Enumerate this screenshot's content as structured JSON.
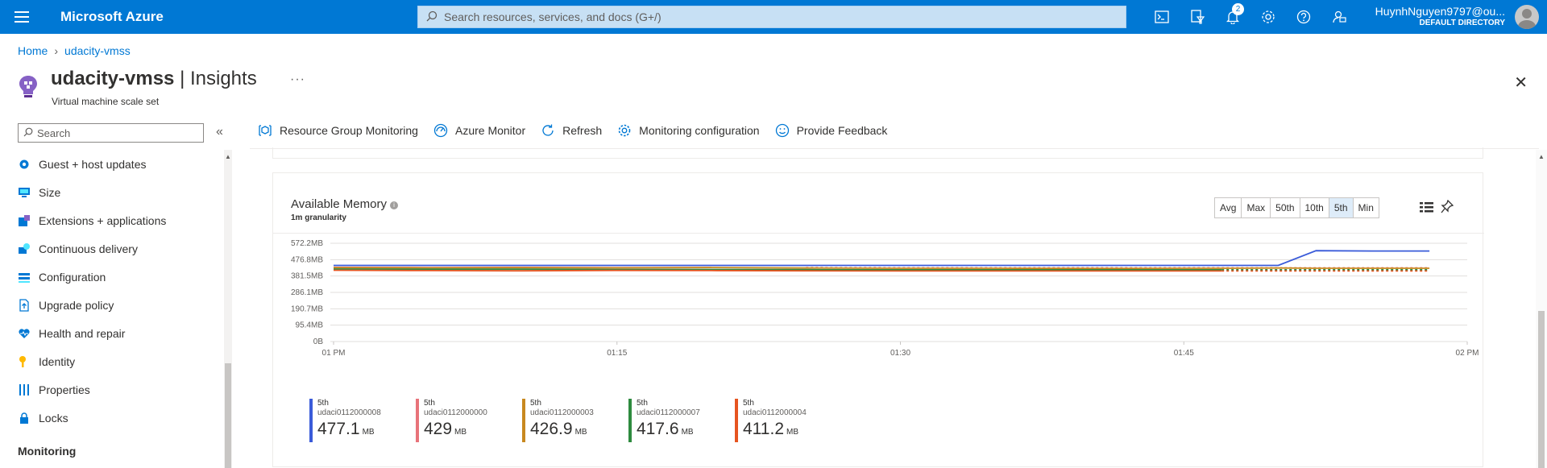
{
  "topbar": {
    "brand": "Microsoft Azure",
    "search_placeholder": "Search resources, services, and docs (G+/)",
    "notification_count": "2",
    "user_name": "HuynhNguyen9797@ou...",
    "user_directory": "DEFAULT DIRECTORY"
  },
  "breadcrumb": {
    "home": "Home",
    "resource": "udacity-vmss"
  },
  "header": {
    "resource_name": "udacity-vmss",
    "blade": "Insights",
    "subtitle": "Virtual machine scale set"
  },
  "sidebar": {
    "search_placeholder": "Search",
    "items": [
      {
        "label": "Guest + host updates",
        "icon": "gear-icon"
      },
      {
        "label": "Size",
        "icon": "monitor-icon"
      },
      {
        "label": "Extensions + applications",
        "icon": "extension-icon"
      },
      {
        "label": "Continuous delivery",
        "icon": "delivery-icon"
      },
      {
        "label": "Configuration",
        "icon": "config-icon"
      },
      {
        "label": "Upgrade policy",
        "icon": "upgrade-icon"
      },
      {
        "label": "Health and repair",
        "icon": "heart-icon"
      },
      {
        "label": "Identity",
        "icon": "key-icon"
      },
      {
        "label": "Properties",
        "icon": "properties-icon"
      },
      {
        "label": "Locks",
        "icon": "lock-icon"
      }
    ],
    "group_label": "Monitoring"
  },
  "commands": [
    {
      "label": "Resource Group Monitoring",
      "icon": "resource-group-icon"
    },
    {
      "label": "Azure Monitor",
      "icon": "monitor-gauge-icon"
    },
    {
      "label": "Refresh",
      "icon": "refresh-icon"
    },
    {
      "label": "Monitoring configuration",
      "icon": "gear-icon"
    },
    {
      "label": "Provide Feedback",
      "icon": "smiley-icon"
    }
  ],
  "card": {
    "title": "Available Memory",
    "granularity": "1m granularity",
    "aggregations": [
      "Avg",
      "Max",
      "50th",
      "10th",
      "5th",
      "Min"
    ],
    "selected_aggregation": "5th"
  },
  "colors": {
    "azure_blue": "#0078d4",
    "series_008": "#3a5bd9",
    "series_000": "#e8737a",
    "series_003": "#c8891f",
    "series_007": "#2e8b3f",
    "series_004": "#e65420"
  },
  "chart_data": {
    "type": "line",
    "title": "Available Memory",
    "ylabel": "",
    "xlabel": "",
    "y_ticks": [
      "572.2MB",
      "476.8MB",
      "381.5MB",
      "286.1MB",
      "190.7MB",
      "95.4MB",
      "0B"
    ],
    "x_ticks": [
      "01 PM",
      "01:15",
      "01:30",
      "01:45",
      "02 PM"
    ],
    "ylim": [
      0,
      572.2
    ],
    "grid": true,
    "x_minutes": [
      0,
      5,
      10,
      15,
      20,
      25,
      30,
      35,
      40,
      45,
      47,
      50,
      52,
      55,
      58
    ],
    "series": [
      {
        "name": "udaci0112000008",
        "color": "#3a5bd9",
        "solid_until": 58,
        "values": [
          443,
          443,
          443,
          443,
          443,
          443,
          443,
          443,
          443,
          443,
          443,
          443,
          529,
          527,
          527
        ]
      },
      {
        "name": "udaci0112000000",
        "color": "#e8737a",
        "solid_until": 24,
        "values": [
          432,
          431,
          432,
          430,
          431,
          430,
          429,
          429,
          429,
          429,
          429,
          429,
          429,
          429,
          429
        ]
      },
      {
        "name": "udaci0112000003",
        "color": "#c8891f",
        "solid_until": 58,
        "values": [
          430,
          429,
          430,
          429,
          431,
          428,
          427,
          427,
          426,
          427,
          427,
          428,
          427,
          427,
          427
        ]
      },
      {
        "name": "udaci0112000007",
        "color": "#2e8b3f",
        "solid_until": 47,
        "values": [
          422,
          421,
          421,
          420,
          420,
          419,
          418,
          418,
          418,
          418,
          418,
          418,
          418,
          418,
          418
        ]
      },
      {
        "name": "udaci0112000004",
        "color": "#e65420",
        "solid_until": 47,
        "values": [
          415,
          413,
          412,
          414,
          413,
          412,
          411,
          411,
          411,
          411,
          411,
          411,
          411,
          411,
          411
        ]
      }
    ]
  },
  "legend": [
    {
      "percentile": "5th",
      "name": "udaci0112000008",
      "value": "477.1",
      "unit": "MB",
      "color": "#3a5bd9"
    },
    {
      "percentile": "5th",
      "name": "udaci0112000000",
      "value": "429",
      "unit": "MB",
      "color": "#e8737a"
    },
    {
      "percentile": "5th",
      "name": "udaci0112000003",
      "value": "426.9",
      "unit": "MB",
      "color": "#c8891f"
    },
    {
      "percentile": "5th",
      "name": "udaci0112000007",
      "value": "417.6",
      "unit": "MB",
      "color": "#2e8b3f"
    },
    {
      "percentile": "5th",
      "name": "udaci0112000004",
      "value": "411.2",
      "unit": "MB",
      "color": "#e65420"
    }
  ]
}
